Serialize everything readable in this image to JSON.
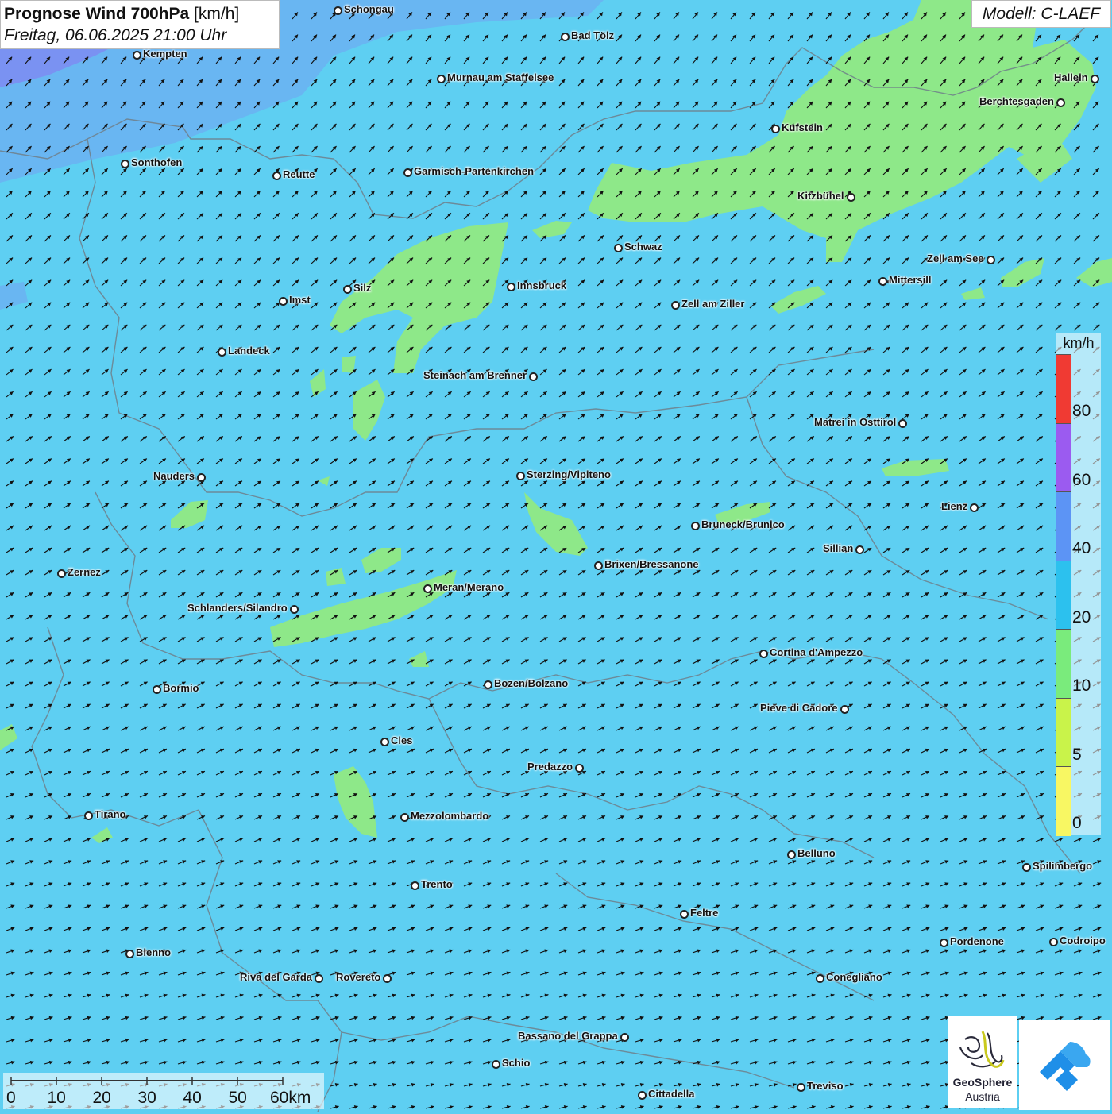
{
  "header": {
    "title_bold": "Prognose Wind 700hPa",
    "title_unit": "[km/h]",
    "subtitle": "Freitag, 06.06.2025 21:00 Uhr",
    "model": "Modell: C-LAEF"
  },
  "legend": {
    "unit": "km/h",
    "labels": [
      "80",
      "60",
      "40",
      "20",
      "10",
      "5",
      "0"
    ],
    "colors": [
      "#f03a33",
      "#9b5bf0",
      "#5c94f5",
      "#2cc1ee",
      "#7aeb7c",
      "#c9f34a",
      "#f8f763"
    ]
  },
  "scale": {
    "labels": [
      "0",
      "10",
      "20",
      "30",
      "40",
      "50",
      "60km"
    ]
  },
  "logo": {
    "name_line1": "GeoSphere",
    "name_line2": "Austria"
  },
  "map": {
    "base_color": "#5ecff2",
    "calm_color": "#8ee889",
    "strong_color": "#7c8ef2",
    "wind_direction": "from south-west toward north-east"
  },
  "cities": [
    {
      "name": "Schongau"
    },
    {
      "name": "Kempten"
    },
    {
      "name": "Bad Tölz"
    },
    {
      "name": "Murnau am Staffelsee"
    },
    {
      "name": "Hallein"
    },
    {
      "name": "Berchtesgaden"
    },
    {
      "name": "Kufstein"
    },
    {
      "name": "Sonthofen"
    },
    {
      "name": "Reutte"
    },
    {
      "name": "Garmisch-Partenkirchen"
    },
    {
      "name": "Kitzbühel"
    },
    {
      "name": "Schwaz"
    },
    {
      "name": "Zell am See"
    },
    {
      "name": "Mittersill"
    },
    {
      "name": "Imst"
    },
    {
      "name": "Silz"
    },
    {
      "name": "Innsbruck"
    },
    {
      "name": "Zell am Ziller"
    },
    {
      "name": "Landeck"
    },
    {
      "name": "Steinach am Brenner"
    },
    {
      "name": "Matrei in Osttirol"
    },
    {
      "name": "Nauders"
    },
    {
      "name": "Sterzing/Vipiteno"
    },
    {
      "name": "Lienz"
    },
    {
      "name": "Bruneck/Brunico"
    },
    {
      "name": "Sillian"
    },
    {
      "name": "Brixen/Bressanone"
    },
    {
      "name": "Zernez"
    },
    {
      "name": "Meran/Merano"
    },
    {
      "name": "Schlanders/Silandro"
    },
    {
      "name": "Cortina d'Ampezzo"
    },
    {
      "name": "Bozen/Bolzano"
    },
    {
      "name": "Bormio"
    },
    {
      "name": "Pieve di Cadore"
    },
    {
      "name": "Cles"
    },
    {
      "name": "Predazzo"
    },
    {
      "name": "Tirano"
    },
    {
      "name": "Mezzolombardo"
    },
    {
      "name": "Belluno"
    },
    {
      "name": "Spilimbergo"
    },
    {
      "name": "Trento"
    },
    {
      "name": "Feltre"
    },
    {
      "name": "Bienno"
    },
    {
      "name": "Pordenone"
    },
    {
      "name": "Codroipo"
    },
    {
      "name": "Riva del Garda"
    },
    {
      "name": "Rovereto"
    },
    {
      "name": "Conegliano"
    },
    {
      "name": "Bassano del Grappa"
    },
    {
      "name": "Schio"
    },
    {
      "name": "Treviso"
    },
    {
      "name": "Cittadella"
    }
  ]
}
